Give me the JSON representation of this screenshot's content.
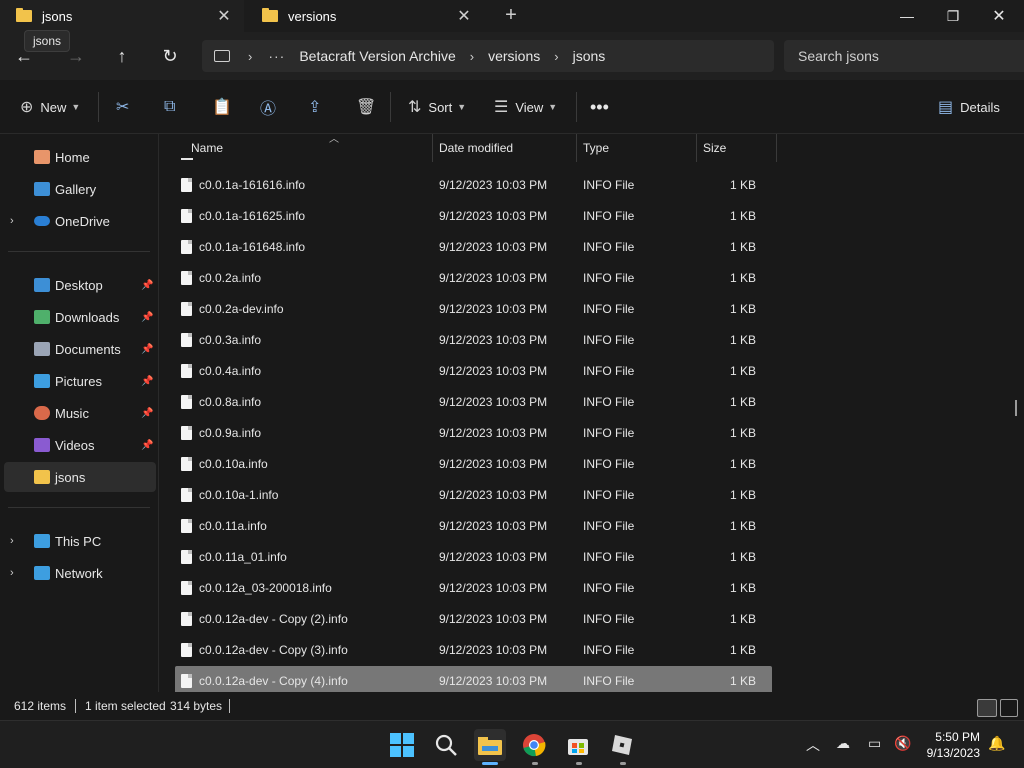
{
  "tabs": [
    {
      "label": "jsons",
      "active": true
    },
    {
      "label": "versions",
      "active": false
    }
  ],
  "tooltip": "jsons",
  "breadcrumb": [
    "Betacraft Version Archive",
    "versions",
    "jsons"
  ],
  "search": {
    "placeholder": "Search jsons"
  },
  "toolbar": {
    "new_label": "New",
    "sort_label": "Sort",
    "view_label": "View",
    "details_label": "Details"
  },
  "sidebar": {
    "items": [
      {
        "label": "Home"
      },
      {
        "label": "Gallery"
      },
      {
        "label": "OneDrive"
      },
      {
        "label": "Desktop"
      },
      {
        "label": "Downloads"
      },
      {
        "label": "Documents"
      },
      {
        "label": "Pictures"
      },
      {
        "label": "Music"
      },
      {
        "label": "Videos"
      },
      {
        "label": "jsons"
      },
      {
        "label": "This PC"
      },
      {
        "label": "Network"
      }
    ]
  },
  "columns": {
    "name": "Name",
    "date": "Date modified",
    "type": "Type",
    "size": "Size"
  },
  "files": [
    {
      "name": "c0.0.1a-161616.info",
      "date": "9/12/2023 10:03 PM",
      "type": "INFO File",
      "size": "1 KB"
    },
    {
      "name": "c0.0.1a-161625.info",
      "date": "9/12/2023 10:03 PM",
      "type": "INFO File",
      "size": "1 KB"
    },
    {
      "name": "c0.0.1a-161648.info",
      "date": "9/12/2023 10:03 PM",
      "type": "INFO File",
      "size": "1 KB"
    },
    {
      "name": "c0.0.2a.info",
      "date": "9/12/2023 10:03 PM",
      "type": "INFO File",
      "size": "1 KB"
    },
    {
      "name": "c0.0.2a-dev.info",
      "date": "9/12/2023 10:03 PM",
      "type": "INFO File",
      "size": "1 KB"
    },
    {
      "name": "c0.0.3a.info",
      "date": "9/12/2023 10:03 PM",
      "type": "INFO File",
      "size": "1 KB"
    },
    {
      "name": "c0.0.4a.info",
      "date": "9/12/2023 10:03 PM",
      "type": "INFO File",
      "size": "1 KB"
    },
    {
      "name": "c0.0.8a.info",
      "date": "9/12/2023 10:03 PM",
      "type": "INFO File",
      "size": "1 KB"
    },
    {
      "name": "c0.0.9a.info",
      "date": "9/12/2023 10:03 PM",
      "type": "INFO File",
      "size": "1 KB"
    },
    {
      "name": "c0.0.10a.info",
      "date": "9/12/2023 10:03 PM",
      "type": "INFO File",
      "size": "1 KB"
    },
    {
      "name": "c0.0.10a-1.info",
      "date": "9/12/2023 10:03 PM",
      "type": "INFO File",
      "size": "1 KB"
    },
    {
      "name": "c0.0.11a.info",
      "date": "9/12/2023 10:03 PM",
      "type": "INFO File",
      "size": "1 KB"
    },
    {
      "name": "c0.0.11a_01.info",
      "date": "9/12/2023 10:03 PM",
      "type": "INFO File",
      "size": "1 KB"
    },
    {
      "name": "c0.0.12a_03-200018.info",
      "date": "9/12/2023 10:03 PM",
      "type": "INFO File",
      "size": "1 KB"
    },
    {
      "name": "c0.0.12a-dev - Copy (2).info",
      "date": "9/12/2023 10:03 PM",
      "type": "INFO File",
      "size": "1 KB"
    },
    {
      "name": "c0.0.12a-dev - Copy (3).info",
      "date": "9/12/2023 10:03 PM",
      "type": "INFO File",
      "size": "1 KB"
    },
    {
      "name": "c0.0.12a-dev - Copy (4).info",
      "date": "9/12/2023 10:03 PM",
      "type": "INFO File",
      "size": "1 KB",
      "selected": true
    }
  ],
  "status": {
    "items": "612 items",
    "selection": "1 item selected",
    "size": "314 bytes"
  },
  "clock": {
    "time": "5:50 PM",
    "date": "9/13/2023"
  },
  "colors": {
    "folder": "#f2c34b",
    "accent": "#5eb3ff",
    "selected_row": "#777777"
  }
}
